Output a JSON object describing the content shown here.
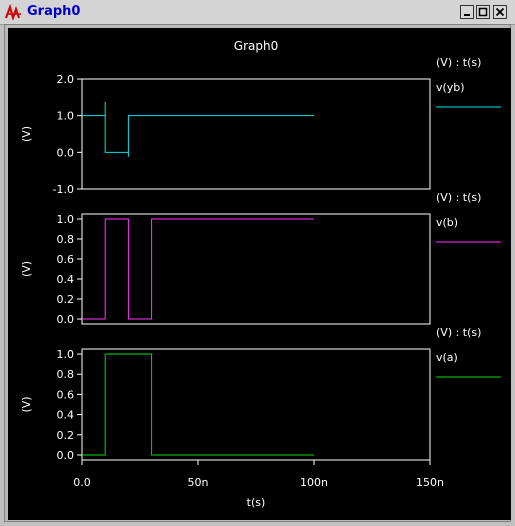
{
  "window": {
    "title": "Graph0",
    "icon": "waveform-app-icon"
  },
  "colors": {
    "background": "#000000",
    "text": "#ffffff",
    "frame": "#ffffff",
    "yb": "#00e5e5",
    "b": "#ff33ff",
    "a": "#00dd00"
  },
  "chart_data": {
    "type": "line",
    "title": "Graph0",
    "xlabel": "t(s)",
    "xlim": [
      0,
      1.5e-07
    ],
    "xticks": [
      "0.0",
      "50n",
      "100n",
      "150n"
    ],
    "panels": [
      {
        "ylabel": "(V)",
        "legend_header": "(V) : t(s)",
        "ylim": [
          -1.0,
          2.0
        ],
        "yticks": [
          "2.0",
          "1.0",
          "0.0",
          "-1.0"
        ],
        "series": [
          {
            "name": "v(yb)",
            "color": "#00e5e5",
            "x": [
              0,
              1e-08,
              1e-08,
              1e-08,
              2e-08,
              2e-08,
              2e-08,
              3e-08,
              3e-08,
              1e-07
            ],
            "y": [
              1.0,
              1.0,
              1.38,
              0.0,
              0.0,
              -0.12,
              1.0,
              1.0,
              1.0,
              1.0
            ]
          }
        ]
      },
      {
        "ylabel": "(V)",
        "legend_header": "(V) : t(s)",
        "ylim": [
          -0.05,
          1.05
        ],
        "yticks": [
          "1.0",
          "0.8",
          "0.6",
          "0.4",
          "0.2",
          "0.0"
        ],
        "series": [
          {
            "name": "v(b)",
            "color": "#ff33ff",
            "x": [
              0,
              1e-08,
              1e-08,
              2e-08,
              2e-08,
              3e-08,
              3e-08,
              1e-07
            ],
            "y": [
              0.0,
              0.0,
              1.0,
              1.0,
              0.0,
              0.0,
              1.0,
              1.0
            ]
          }
        ]
      },
      {
        "ylabel": "(V)",
        "legend_header": "(V) : t(s)",
        "ylim": [
          -0.05,
          1.05
        ],
        "yticks": [
          "1.0",
          "0.8",
          "0.6",
          "0.4",
          "0.2",
          "0.0"
        ],
        "series": [
          {
            "name": "v(a)",
            "color": "#00dd00",
            "x": [
              0,
              1e-08,
              1e-08,
              3e-08,
              3e-08,
              1e-07
            ],
            "y": [
              0.0,
              0.0,
              1.0,
              1.0,
              0.0,
              0.0
            ]
          }
        ]
      }
    ]
  }
}
